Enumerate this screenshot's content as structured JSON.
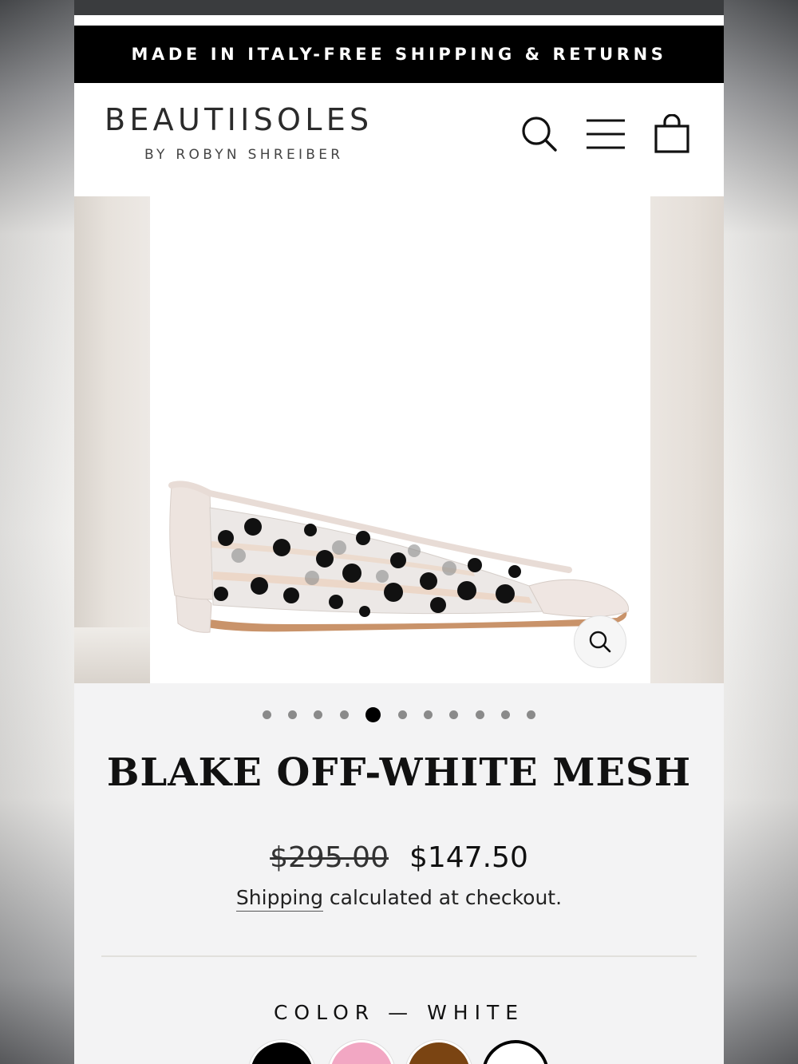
{
  "announcement": "MADE IN ITALY-FREE SHIPPING & RETURNS",
  "brand": {
    "name": "BEAUTIISOLES",
    "tagline": "BY ROBYN SHREIBER"
  },
  "header_icons": [
    "search-icon",
    "menu-icon",
    "cart-icon"
  ],
  "gallery": {
    "slide_count": 11,
    "active_slide": 5
  },
  "product": {
    "title": "BLAKE OFF-WHITE MESH",
    "price_original": "$295.00",
    "price_sale": "$147.50",
    "shipping_link": "Shipping",
    "shipping_rest": " calculated at checkout.",
    "color_label": "COLOR",
    "color_separator": "—",
    "color_value": "WHITE"
  },
  "swatches": [
    {
      "name": "black",
      "color": "#000000"
    },
    {
      "name": "pink",
      "color": "#f2a7c3"
    },
    {
      "name": "brown",
      "color": "#7a4412"
    },
    {
      "name": "white",
      "color": "#ffffff",
      "selected": true
    }
  ],
  "colors": {
    "announcement_bg": "#000000",
    "page_bg": "#f3f3f4",
    "text": "#111111"
  }
}
